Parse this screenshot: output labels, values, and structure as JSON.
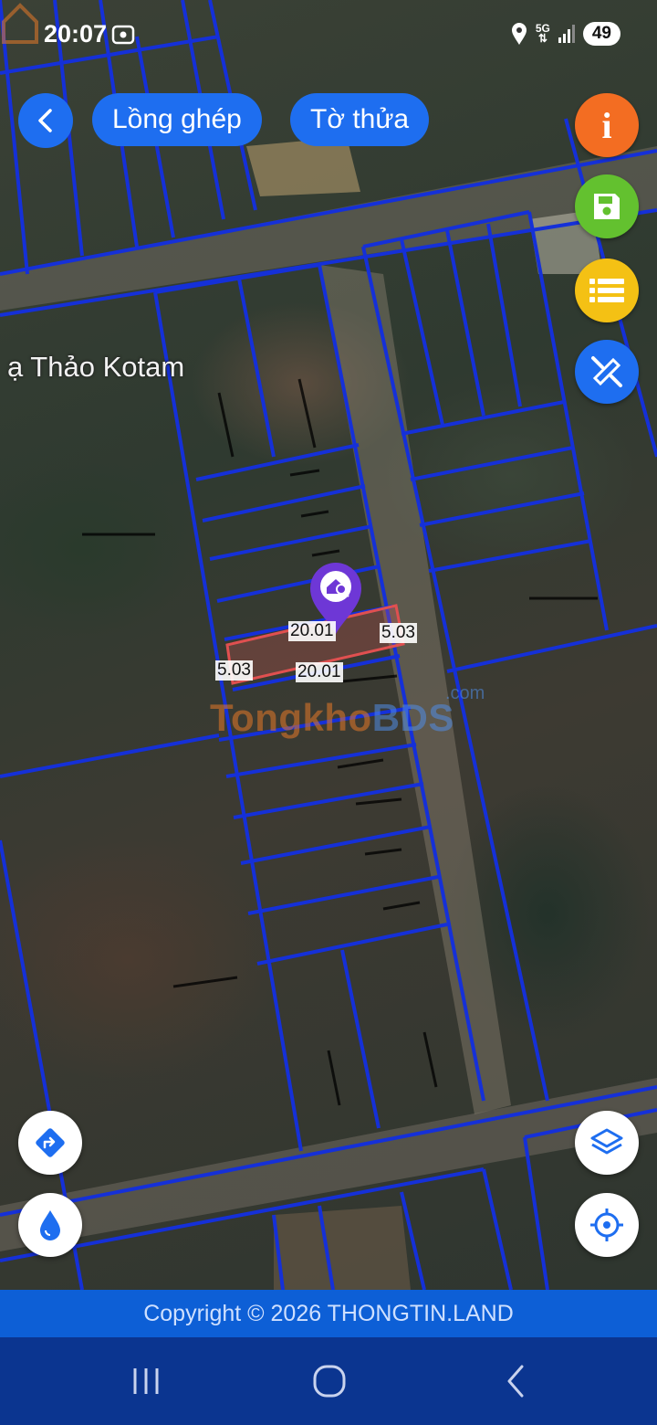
{
  "status_bar": {
    "time": "20:07",
    "network": "5G",
    "battery": "49"
  },
  "toolbar": {
    "overlay_label": "Lồng ghép",
    "parcel_label": "Tờ thửa"
  },
  "map": {
    "place_label": "ạ Thảo Kotam",
    "measurements": {
      "top_length": "20.01",
      "right_width": "5.03",
      "left_width": "5.03",
      "bottom_length": "20.01"
    },
    "watermark": {
      "part1": "Tongkho",
      "part2": "BDS",
      "suffix": ".com"
    }
  },
  "footer": {
    "copyright": "Copyright © 2026 THONGTIN.LAND"
  },
  "colors": {
    "primary": "#1e6ef0",
    "info": "#f36d22",
    "save": "#63c12f",
    "list": "#f4c114",
    "footer": "#0d5fd6",
    "navbar": "#0b3590",
    "parcel_line": "#1530d8",
    "selected_parcel": "#e05050"
  },
  "icons": {
    "back": "chevron-left-icon",
    "info": "info-icon",
    "save": "save-icon",
    "list": "list-icon",
    "measure": "ruler-pencil-icon",
    "direction": "direction-icon",
    "water": "water-drop-icon",
    "layers": "layers-icon",
    "locate": "crosshair-icon",
    "pin": "search-home-pin-icon"
  }
}
